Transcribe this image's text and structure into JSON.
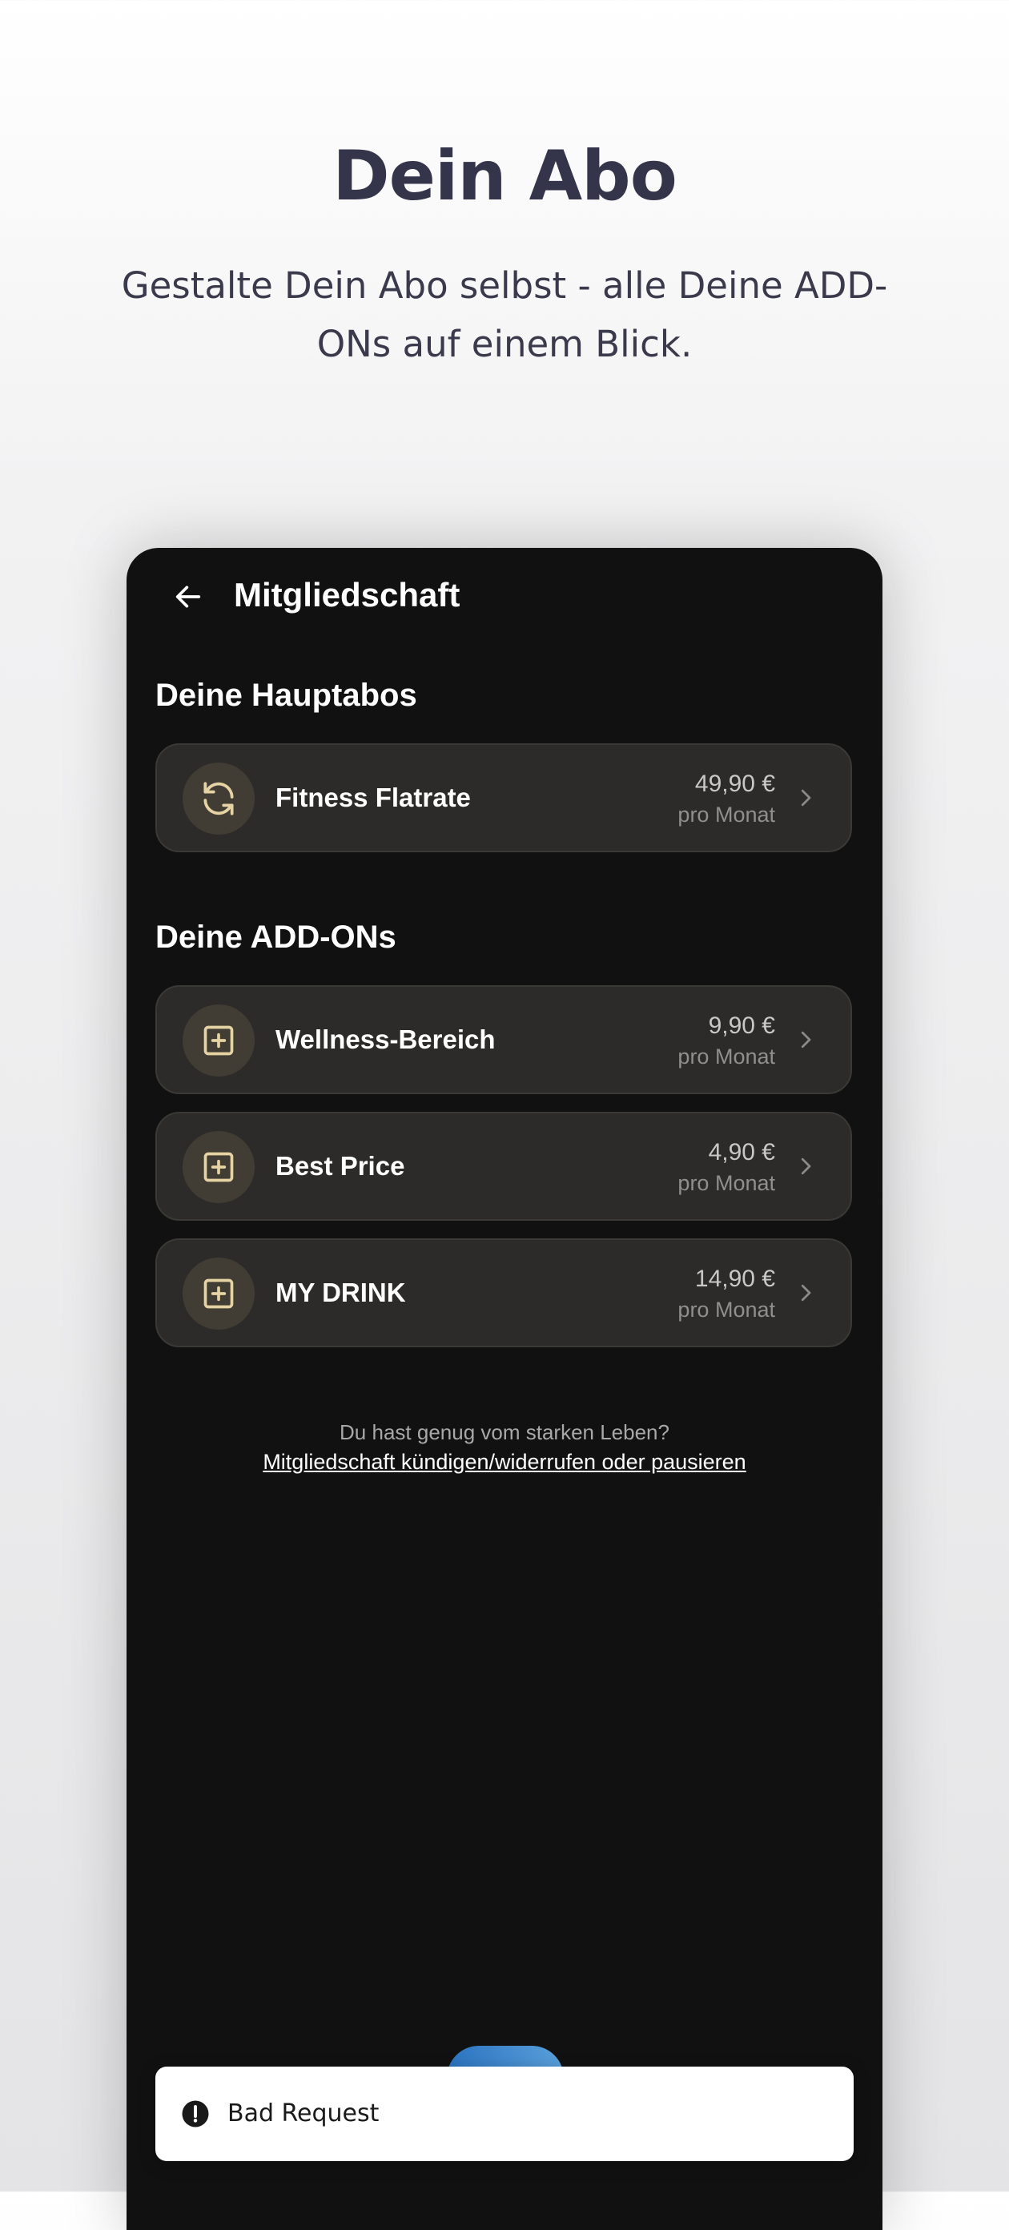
{
  "promo": {
    "title": "Dein Abo",
    "subtitle": "Gestalte Dein Abo selbst - alle Deine ADD-ONs auf einem Blick."
  },
  "screen": {
    "title": "Mitgliedschaft"
  },
  "main_section": {
    "title": "Deine Hauptabos",
    "items": [
      {
        "label": "Fitness Flatrate",
        "price": "49,90 €",
        "period": "pro Monat",
        "icon": "refresh-icon"
      }
    ]
  },
  "addons_section": {
    "title": "Deine ADD-ONs",
    "items": [
      {
        "label": "Wellness-Bereich",
        "price": "9,90 €",
        "period": "pro Monat",
        "icon": "plus-square-icon"
      },
      {
        "label": "Best Price",
        "price": "4,90 €",
        "period": "pro Monat",
        "icon": "plus-square-icon"
      },
      {
        "label": "MY DRINK",
        "price": "14,90 €",
        "period": "pro Monat",
        "icon": "plus-square-icon"
      }
    ]
  },
  "footer": {
    "question": "Du hast genug vom starken Leben?",
    "link": "Mitgliedschaft kündigen/widerrufen oder pausieren"
  },
  "snackbar": {
    "message": "Bad Request",
    "icon": "error-icon"
  },
  "colors": {
    "screen_bg": "#111111",
    "card_bg": "#2c2b29",
    "icon_circle": "#423d34",
    "icon_accent": "#e6d3a3",
    "promo_text": "#34344a"
  }
}
